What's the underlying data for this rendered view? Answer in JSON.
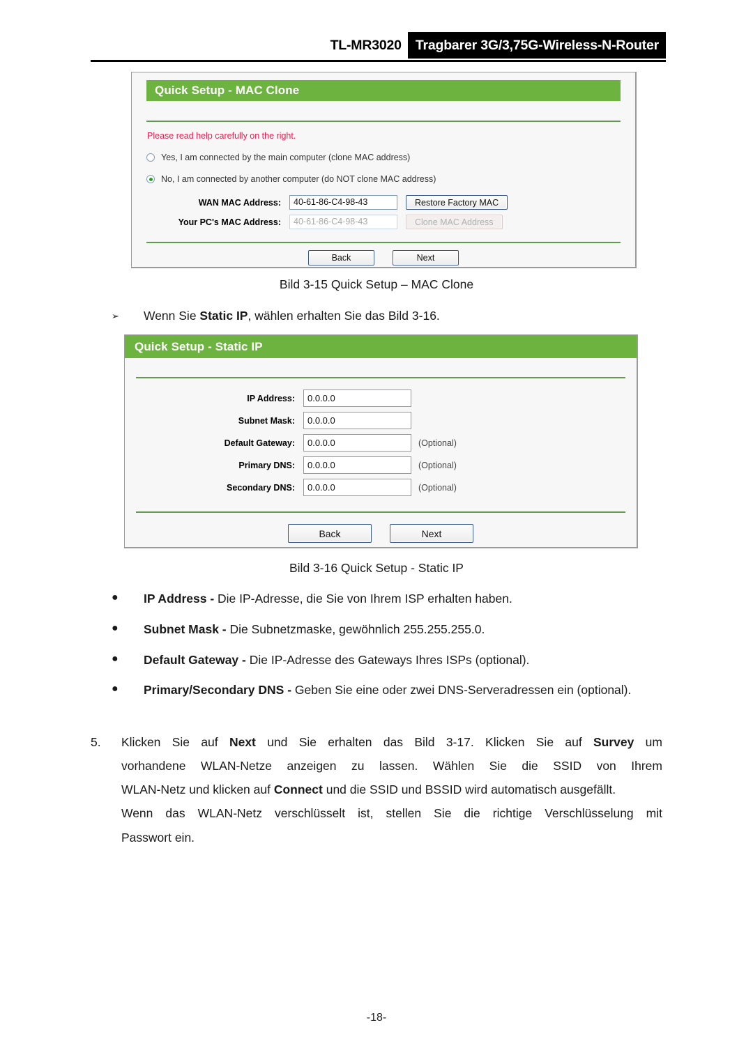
{
  "header": {
    "model": "TL-MR3020",
    "product": "Tragbarer 3G/3,75G-Wireless-N-Router"
  },
  "mac_clone_panel": {
    "title": "Quick Setup - MAC Clone",
    "help_note": "Please read help carefully on the right.",
    "radios": [
      {
        "label": "Yes, I am connected by the main computer (clone MAC address)",
        "checked": false
      },
      {
        "label": "No, I am connected by another computer (do NOT clone MAC address)",
        "checked": true
      }
    ],
    "fields": [
      {
        "label": "WAN MAC Address:",
        "value": "40-61-86-C4-98-43",
        "button": "Restore Factory MAC",
        "disabled": false
      },
      {
        "label": "Your PC's MAC Address:",
        "value": "40-61-86-C4-98-43",
        "button": "Clone MAC Address",
        "disabled": true
      }
    ],
    "back_label": "Back",
    "next_label": "Next"
  },
  "static_ip_panel": {
    "title": "Quick Setup - Static IP",
    "fields": [
      {
        "label": "IP Address:",
        "value": "0.0.0.0",
        "optional": ""
      },
      {
        "label": "Subnet Mask:",
        "value": "0.0.0.0",
        "optional": ""
      },
      {
        "label": "Default Gateway:",
        "value": "0.0.0.0",
        "optional": "(Optional)"
      },
      {
        "label": "Primary DNS:",
        "value": "0.0.0.0",
        "optional": "(Optional)"
      },
      {
        "label": "Secondary DNS:",
        "value": "0.0.0.0",
        "optional": "(Optional)"
      }
    ],
    "back_label": "Back",
    "next_label": "Next"
  },
  "captions": {
    "fig_315": "Bild 3-15 Quick Setup – MAC Clone",
    "fig_316": "Bild 3-16 Quick Setup - Static IP"
  },
  "arrow_item": {
    "marker": "➢",
    "prefix": "Wenn Sie ",
    "bold": "Static IP",
    "suffix": ", wählen erhalten Sie das Bild 3-16."
  },
  "bullets": {
    "marker": "●",
    "items": [
      {
        "bold": "IP Address - ",
        "text": "Die IP-Adresse, die Sie von Ihrem ISP erhalten haben."
      },
      {
        "bold": "Subnet Mask - ",
        "text": "Die Subnetzmaske, gewöhnlich 255.255.255.0."
      },
      {
        "bold": "Default Gateway - ",
        "text": "Die IP-Adresse des Gateways Ihres ISPs (optional)."
      },
      {
        "bold": "Primary/Secondary DNS - ",
        "text": "Geben Sie eine oder zwei DNS-Serveradressen ein (optional)."
      }
    ]
  },
  "numbered_step": {
    "number": "5.",
    "line1_a": "Klicken Sie auf ",
    "line1_b": "Next",
    "line1_c": " und Sie erhalten das Bild 3-17. Klicken Sie auf ",
    "line1_d": "Survey",
    "line1_e": " um",
    "line2": "vorhandene WLAN-Netze anzeigen zu lassen. Wählen Sie die SSID von Ihrem",
    "line3_a": "WLAN-Netz und klicken auf ",
    "line3_b": "Connect",
    "line3_c": " und die SSID und BSSID wird automatisch ausgefällt.",
    "line4": "Wenn das WLAN-Netz verschlüsselt ist, stellen Sie die richtige Verschlüsselung mit",
    "line5": "Passwort ein."
  },
  "page_number": "-18-"
}
